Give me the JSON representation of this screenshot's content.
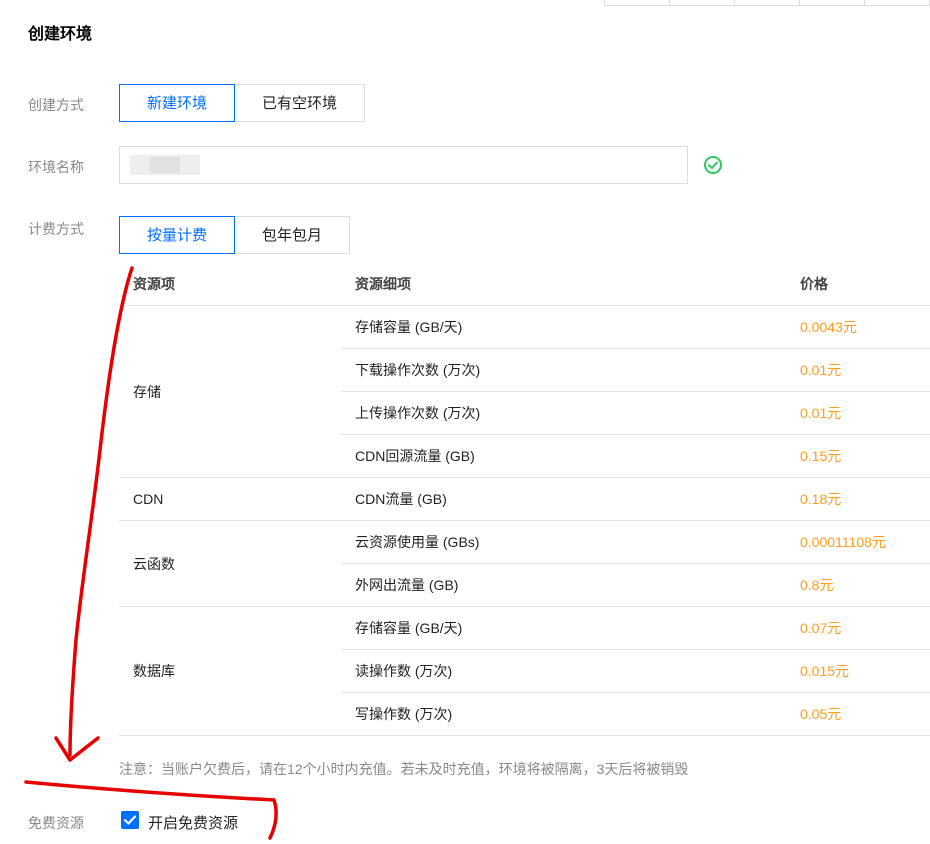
{
  "page": {
    "title": "创建环境"
  },
  "form": {
    "create_mode": {
      "label": "创建方式",
      "options": [
        "新建环境",
        "已有空环境"
      ],
      "selected": "新建环境"
    },
    "env_name": {
      "label": "环境名称",
      "value": ""
    },
    "billing": {
      "label": "计费方式",
      "options": [
        "按量计费",
        "包年包月"
      ],
      "selected": "按量计费"
    }
  },
  "pricing_table": {
    "headers": [
      "资源项",
      "资源细项",
      "价格"
    ],
    "groups": [
      {
        "item": "存储",
        "rows": [
          {
            "detail": "存储容量 (GB/天)",
            "price": "0.0043元"
          },
          {
            "detail": "下载操作次数 (万次)",
            "price": "0.01元"
          },
          {
            "detail": "上传操作次数 (万次)",
            "price": "0.01元"
          },
          {
            "detail": "CDN回源流量 (GB)",
            "price": "0.15元"
          }
        ]
      },
      {
        "item": "CDN",
        "rows": [
          {
            "detail": "CDN流量 (GB)",
            "price": "0.18元"
          }
        ]
      },
      {
        "item": "云函数",
        "rows": [
          {
            "detail": "云资源使用量 (GBs)",
            "price": "0.00011108元"
          },
          {
            "detail": "外网出流量 (GB)",
            "price": "0.8元"
          }
        ]
      },
      {
        "item": "数据库",
        "rows": [
          {
            "detail": "存储容量 (GB/天)",
            "price": "0.07元"
          },
          {
            "detail": "读操作数 (万次)",
            "price": "0.015元"
          },
          {
            "detail": "写操作数 (万次)",
            "price": "0.05元"
          }
        ]
      }
    ]
  },
  "note": "注意：当账户欠费后，请在12个小时内充值。若未及时充值，环境将被隔离，3天后将被销毁",
  "free_resource": {
    "label": "免费资源",
    "checkbox_label": "开启免费资源",
    "checked": true
  },
  "colors": {
    "primary": "#006eff",
    "price": "#ff9c19",
    "success": "#29cc5c",
    "annotation": "#e60000"
  }
}
